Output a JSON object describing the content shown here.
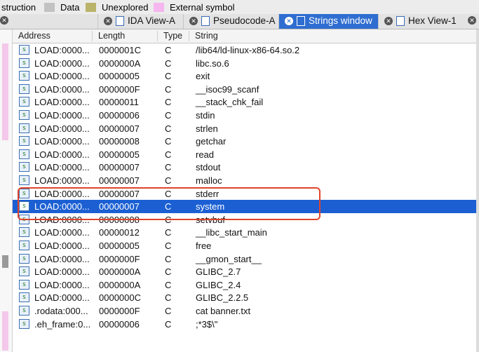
{
  "legend": {
    "items": [
      {
        "label": "struction",
        "color": null
      },
      {
        "label": "Data",
        "color": "#c2c2c2"
      },
      {
        "label": "Unexplored",
        "color": "#b9b46a"
      },
      {
        "label": "External symbol",
        "color": "#f6b6ef"
      }
    ]
  },
  "tabs": [
    {
      "label": "IDA View-A",
      "active": false
    },
    {
      "label": "Pseudocode-A",
      "active": false
    },
    {
      "label": "Strings window",
      "active": true
    },
    {
      "label": "Hex View-1",
      "active": false
    }
  ],
  "columns": {
    "address": "Address",
    "length": "Length",
    "type": "Type",
    "string": "String"
  },
  "rows": [
    {
      "address": "LOAD:0000...",
      "length": "0000001C",
      "type": "C",
      "string": "/lib64/ld-linux-x86-64.so.2"
    },
    {
      "address": "LOAD:0000...",
      "length": "0000000A",
      "type": "C",
      "string": "libc.so.6"
    },
    {
      "address": "LOAD:0000...",
      "length": "00000005",
      "type": "C",
      "string": "exit"
    },
    {
      "address": "LOAD:0000...",
      "length": "0000000F",
      "type": "C",
      "string": "__isoc99_scanf"
    },
    {
      "address": "LOAD:0000...",
      "length": "00000011",
      "type": "C",
      "string": "__stack_chk_fail"
    },
    {
      "address": "LOAD:0000...",
      "length": "00000006",
      "type": "C",
      "string": "stdin"
    },
    {
      "address": "LOAD:0000...",
      "length": "00000007",
      "type": "C",
      "string": "strlen"
    },
    {
      "address": "LOAD:0000...",
      "length": "00000008",
      "type": "C",
      "string": "getchar"
    },
    {
      "address": "LOAD:0000...",
      "length": "00000005",
      "type": "C",
      "string": "read"
    },
    {
      "address": "LOAD:0000...",
      "length": "00000007",
      "type": "C",
      "string": "stdout"
    },
    {
      "address": "LOAD:0000...",
      "length": "00000007",
      "type": "C",
      "string": "malloc"
    },
    {
      "address": "LOAD:0000...",
      "length": "00000007",
      "type": "C",
      "string": "stderr"
    },
    {
      "address": "LOAD:0000...",
      "length": "00000007",
      "type": "C",
      "string": "system"
    },
    {
      "address": "LOAD:0000...",
      "length": "00000008",
      "type": "C",
      "string": "setvbuf"
    },
    {
      "address": "LOAD:0000...",
      "length": "00000012",
      "type": "C",
      "string": "__libc_start_main"
    },
    {
      "address": "LOAD:0000...",
      "length": "00000005",
      "type": "C",
      "string": "free"
    },
    {
      "address": "LOAD:0000...",
      "length": "0000000F",
      "type": "C",
      "string": "__gmon_start__"
    },
    {
      "address": "LOAD:0000...",
      "length": "0000000A",
      "type": "C",
      "string": "GLIBC_2.7"
    },
    {
      "address": "LOAD:0000...",
      "length": "0000000A",
      "type": "C",
      "string": "GLIBC_2.4"
    },
    {
      "address": "LOAD:0000...",
      "length": "0000000C",
      "type": "C",
      "string": "GLIBC_2.2.5"
    },
    {
      "address": ".rodata:000...",
      "length": "0000000F",
      "type": "C",
      "string": "cat banner.txt"
    },
    {
      "address": ".eh_frame:0...",
      "length": "00000006",
      "type": "C",
      "string": ";*3$\\\""
    }
  ],
  "selected_row": 12,
  "highlight_color": "#e0442a",
  "selection_color": "#1b5fd3"
}
